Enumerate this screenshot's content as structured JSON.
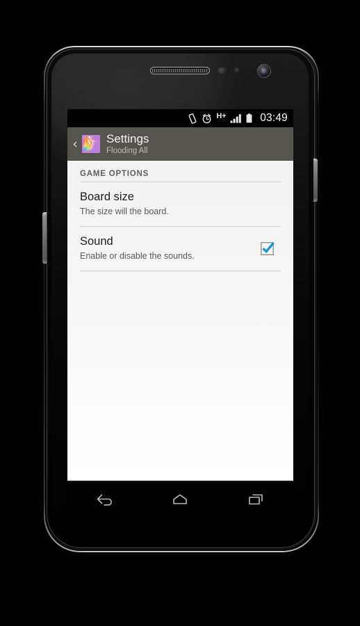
{
  "device": {
    "name": "android-phone",
    "hardware": {
      "earpiece": "earpiece-speaker",
      "proximity_sensor": "proximity-sensor",
      "light_sensor": "light-sensor",
      "front_camera": "front-camera",
      "power_button": "power-button",
      "volume_rocker": "volume-rocker"
    }
  },
  "statusbar": {
    "time": "03:49",
    "network_label": "H+",
    "icons": [
      "vibrate-icon",
      "alarm-clock-icon",
      "hsdpa-plus-icon",
      "signal-bars-icon",
      "battery-icon"
    ]
  },
  "actionbar": {
    "back_glyph": "‹",
    "app_icon": "flooding-all-app-icon",
    "title": "Settings",
    "subtitle": "Flooding All"
  },
  "content": {
    "section_header": "GAME OPTIONS",
    "preferences": [
      {
        "title": "Board size",
        "summary": "The size will the board.",
        "has_checkbox": false
      },
      {
        "title": "Sound",
        "summary": "Enable or disable the sounds.",
        "has_checkbox": true,
        "checked": true
      }
    ]
  },
  "navbar": {
    "buttons": [
      {
        "name": "back-nav-button",
        "label": "Back"
      },
      {
        "name": "home-nav-button",
        "label": "Home"
      },
      {
        "name": "recents-nav-button",
        "label": "Recents"
      }
    ]
  },
  "colors": {
    "actionbar_bg": "#56544f",
    "checkbox_accent": "#1a94cf",
    "statusbar_bg": "#000000",
    "content_top": "#f2f2f2",
    "content_bottom": "#ffffff",
    "divider": "#cfcfcf",
    "nav_icon": "#b9b9b9"
  }
}
